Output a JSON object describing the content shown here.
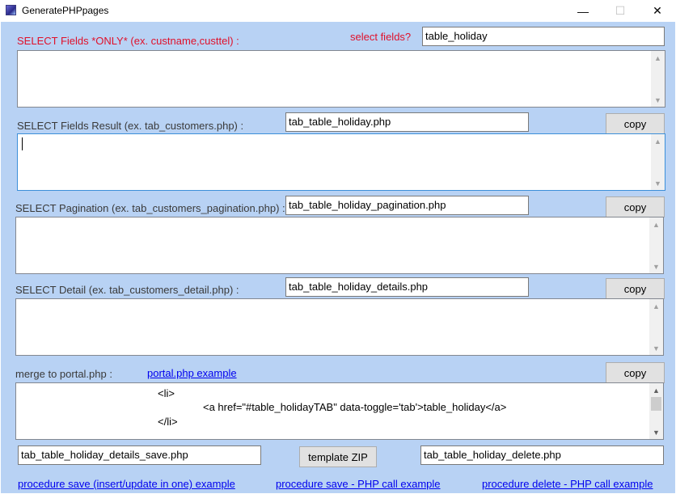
{
  "window": {
    "title": "GeneratePHPpages",
    "minimize_glyph": "—",
    "maximize_glyph": "☐",
    "close_glyph": "✕"
  },
  "select_fields": {
    "label": "SELECT Fields *ONLY* (ex. custname,custtel) :",
    "prompt": "select fields?",
    "table_value": "table_holiday"
  },
  "result": {
    "label": "SELECT Fields Result (ex. tab_customers.php) :",
    "filename": "tab_table_holiday.php",
    "copy_label": "copy"
  },
  "pagination": {
    "label": "SELECT Pagination (ex. tab_customers_pagination.php) :",
    "filename": "tab_table_holiday_pagination.php",
    "copy_label": "copy"
  },
  "detail": {
    "label": "SELECT Detail (ex. tab_customers_detail.php) :",
    "filename": "tab_table_holiday_details.php",
    "copy_label": "copy"
  },
  "portal": {
    "label": "merge to portal.php :",
    "example_link": "portal.php example",
    "copy_label": "copy",
    "code_lines": [
      "<li>",
      "<a href=\"#table_holidayTAB\" data-toggle='tab'>table_holiday</a>",
      "</li>"
    ]
  },
  "bottom": {
    "save_filename": "tab_table_holiday_details_save.php",
    "template_zip_label": "template ZIP",
    "delete_filename": "tab_table_holiday_delete.php"
  },
  "links": {
    "save_procedure": "procedure save (insert/update in one) example",
    "save_php_call": "procedure save - PHP call example",
    "delete_php_call": "procedure delete - PHP call example"
  },
  "icons": {
    "scroll_up": "▲",
    "scroll_down": "▼"
  },
  "colors": {
    "client_bg": "#b8d2f4",
    "label_red": "#e0102a",
    "link_blue": "#0000ee"
  }
}
